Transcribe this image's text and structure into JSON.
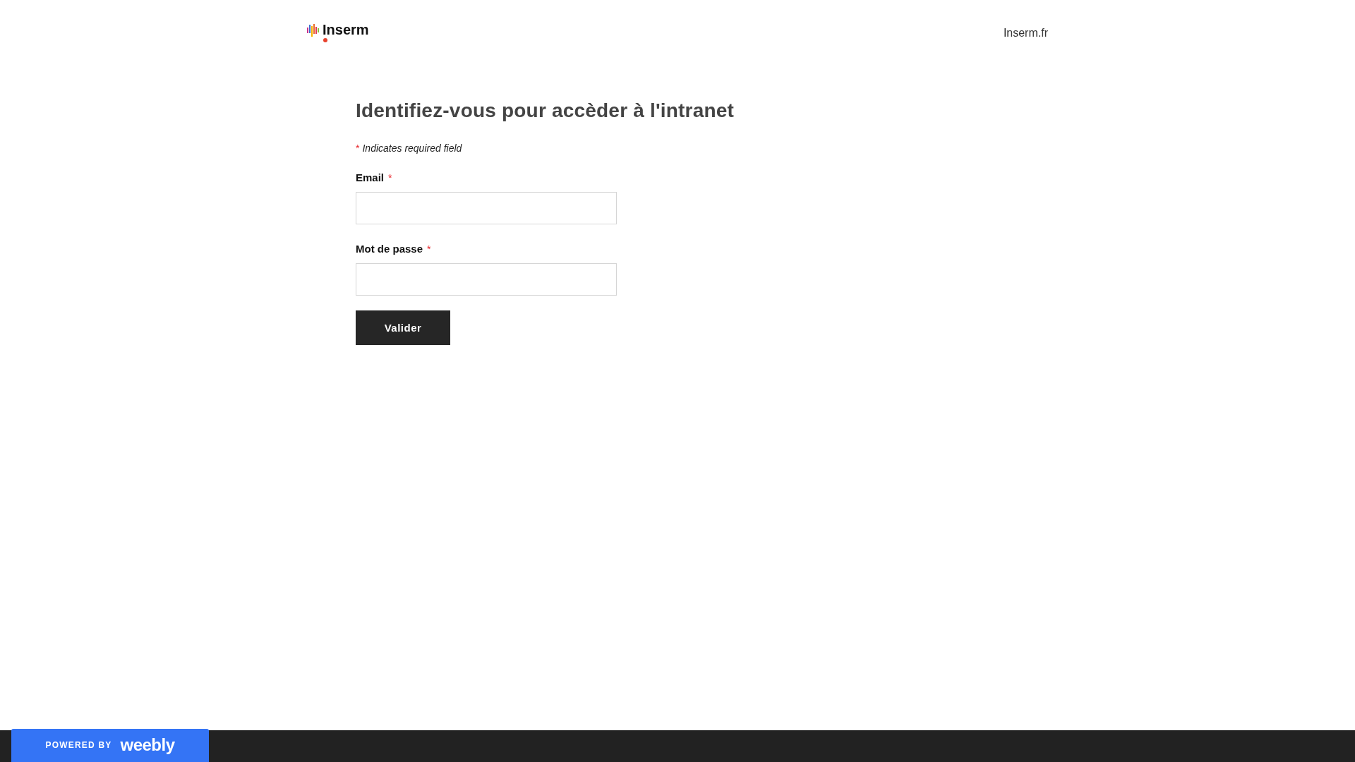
{
  "header": {
    "logo_text": "Inserm",
    "link": "Inserm.fr"
  },
  "form": {
    "title": "Identifiez-vous pour accèder à l'intranet",
    "required_note": {
      "mark": "*",
      "text": "Indicates required field"
    },
    "fields": [
      {
        "label": "Email",
        "required_mark": "*"
      },
      {
        "label": "Mot de passe",
        "required_mark": "*"
      }
    ],
    "submit": "Valider"
  },
  "footer": {
    "badge": {
      "prefix": "POWERED BY",
      "brand": "weebly"
    }
  }
}
